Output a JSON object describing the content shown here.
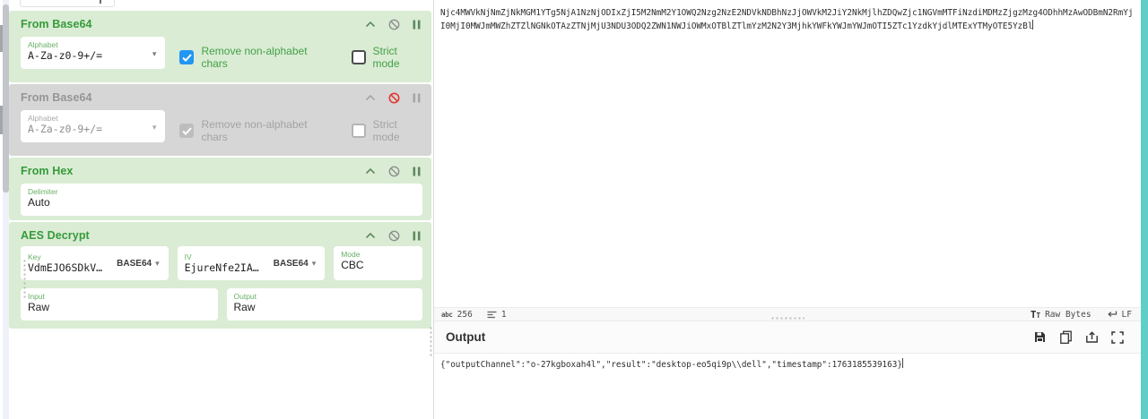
{
  "colors": {
    "op_background": "#daecd4",
    "op_disabled_background": "#d6d6d6",
    "op_title_green": "#359b3a",
    "checkbox_checked_blue": "#2196f3",
    "disable_icon_red": "#e23a34",
    "right_edge_accent": "#5dcfc8"
  },
  "icons": {
    "caret_down": "▾",
    "char_count": "abc",
    "encoding_big": "T",
    "encoding_small": "T"
  },
  "recipe": {
    "operations": [
      {
        "name": "From Base64",
        "disabled": false,
        "args": [
          {
            "label": "Alphabet",
            "value": "A-Za-z0-9+/="
          }
        ],
        "checkboxes": [
          {
            "label": "Remove non-alphabet chars",
            "checked": true
          },
          {
            "label": "Strict mode",
            "checked": false
          }
        ]
      },
      {
        "name": "From Base64",
        "disabled": true,
        "args": [
          {
            "label": "Alphabet",
            "value": "A-Za-z0-9+/="
          }
        ],
        "checkboxes": [
          {
            "label": "Remove non-alphabet chars",
            "checked": true
          },
          {
            "label": "Strict mode",
            "checked": false
          }
        ]
      },
      {
        "name": "From Hex",
        "disabled": false,
        "args": [
          {
            "label": "Delimiter",
            "value": "Auto"
          }
        ]
      },
      {
        "name": "AES Decrypt",
        "disabled": false,
        "args": [
          {
            "label": "Key",
            "value": "VdmEJO6SDkV…",
            "toggle": "BASE64"
          },
          {
            "label": "IV",
            "value": "EjureNfe2IA…",
            "toggle": "BASE64"
          },
          {
            "label": "Mode",
            "value": "CBC"
          },
          {
            "label": "Input",
            "value": "Raw"
          },
          {
            "label": "Output",
            "value": "Raw"
          }
        ]
      }
    ]
  },
  "io": {
    "input": {
      "lines": [
        "Njc4MWVkNjNmZjNkMGM1YTg5NjA1NzNjODIxZjI5M2NmM2Y1OWQ2Nzg2NzE2NDVkNDBhNzJjOWVkM2JiY2NkMjlhZDQwZjc1NGVmMTFiNzdiMDMzZjgzMzg4ODhhMzAwODBmN2RmYj",
        "I0MjI0MWJmMWZhZTZlNGNkOTAzZTNjMjU3NDU3ODQ2ZWN1NWJiOWMxOTBlZTlmYzM2N2Y3MjhkYWFkYWJmYWJmOTI5ZTc1YzdkYjdlMTExYTMyOTE5YzBl"
      ],
      "status": {
        "char_count": "256",
        "line_count": "1",
        "encoding": "Raw Bytes",
        "eol": "LF"
      }
    },
    "output": {
      "title": "Output",
      "text": "{\"outputChannel\":\"o-27kgboxah4l\",\"result\":\"desktop-eo5qi9p\\\\dell\",\"timestamp\":1763185539163}"
    }
  }
}
